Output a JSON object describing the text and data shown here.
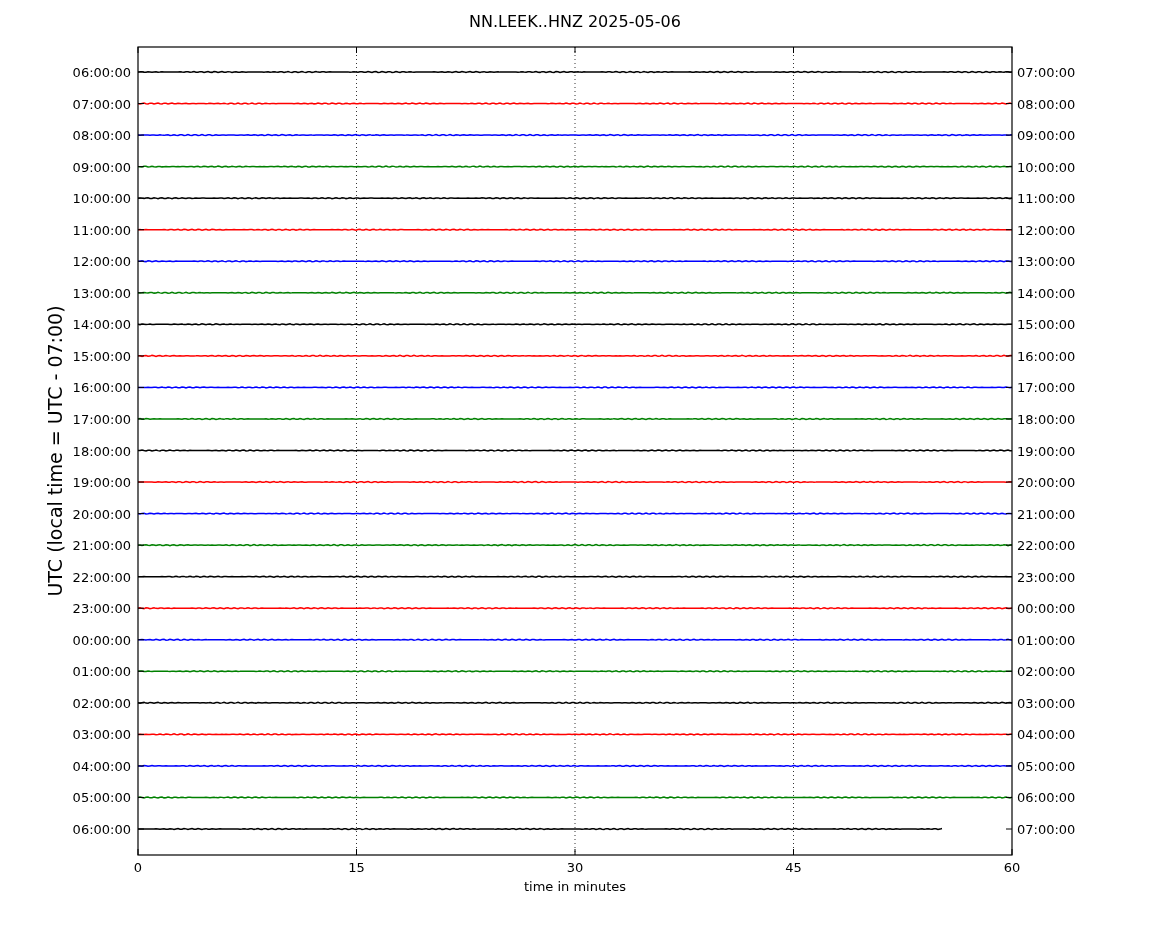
{
  "title": "NN.LEEK..HNZ 2025-05-06",
  "xlabel": "time in minutes",
  "ylabel": "UTC (local time = UTC - 07:00)",
  "xticks": [
    "0",
    "15",
    "30",
    "45",
    "60"
  ],
  "rows": [
    {
      "left": "06:00:00",
      "right": "07:00:00",
      "color": "#000000",
      "partial": false
    },
    {
      "left": "07:00:00",
      "right": "08:00:00",
      "color": "#ff0000",
      "partial": false
    },
    {
      "left": "08:00:00",
      "right": "09:00:00",
      "color": "#0000ff",
      "partial": false
    },
    {
      "left": "09:00:00",
      "right": "10:00:00",
      "color": "#008000",
      "partial": false
    },
    {
      "left": "10:00:00",
      "right": "11:00:00",
      "color": "#000000",
      "partial": false
    },
    {
      "left": "11:00:00",
      "right": "12:00:00",
      "color": "#ff0000",
      "partial": false
    },
    {
      "left": "12:00:00",
      "right": "13:00:00",
      "color": "#0000ff",
      "partial": false
    },
    {
      "left": "13:00:00",
      "right": "14:00:00",
      "color": "#008000",
      "partial": false
    },
    {
      "left": "14:00:00",
      "right": "15:00:00",
      "color": "#000000",
      "partial": false
    },
    {
      "left": "15:00:00",
      "right": "16:00:00",
      "color": "#ff0000",
      "partial": false
    },
    {
      "left": "16:00:00",
      "right": "17:00:00",
      "color": "#0000ff",
      "partial": false
    },
    {
      "left": "17:00:00",
      "right": "18:00:00",
      "color": "#008000",
      "partial": false
    },
    {
      "left": "18:00:00",
      "right": "19:00:00",
      "color": "#000000",
      "partial": false
    },
    {
      "left": "19:00:00",
      "right": "20:00:00",
      "color": "#ff0000",
      "partial": false
    },
    {
      "left": "20:00:00",
      "right": "21:00:00",
      "color": "#0000ff",
      "partial": false
    },
    {
      "left": "21:00:00",
      "right": "22:00:00",
      "color": "#008000",
      "partial": false
    },
    {
      "left": "22:00:00",
      "right": "23:00:00",
      "color": "#000000",
      "partial": false
    },
    {
      "left": "23:00:00",
      "right": "00:00:00",
      "color": "#ff0000",
      "partial": false
    },
    {
      "left": "00:00:00",
      "right": "01:00:00",
      "color": "#0000ff",
      "partial": false
    },
    {
      "left": "01:00:00",
      "right": "02:00:00",
      "color": "#008000",
      "partial": false
    },
    {
      "left": "02:00:00",
      "right": "03:00:00",
      "color": "#000000",
      "partial": false
    },
    {
      "left": "03:00:00",
      "right": "04:00:00",
      "color": "#ff0000",
      "partial": false
    },
    {
      "left": "04:00:00",
      "right": "05:00:00",
      "color": "#0000ff",
      "partial": false
    },
    {
      "left": "05:00:00",
      "right": "06:00:00",
      "color": "#008000",
      "partial": false
    },
    {
      "left": "06:00:00",
      "right": "07:00:00",
      "color": "#000000",
      "partial": true
    }
  ]
}
